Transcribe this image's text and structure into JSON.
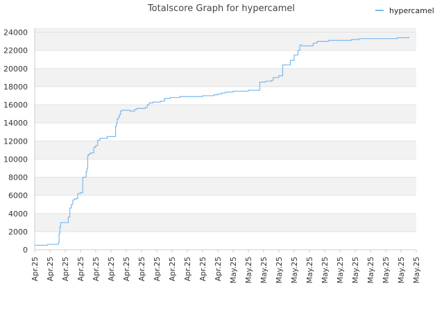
{
  "chart_data": {
    "type": "line",
    "title": "Totalscore Graph for hypercamel",
    "xlabel": "",
    "ylabel": "",
    "ylim": [
      0,
      24500
    ],
    "yticks": [
      0,
      2000,
      4000,
      6000,
      8000,
      10000,
      12000,
      14000,
      16000,
      18000,
      20000,
      22000,
      24000
    ],
    "xticks": [
      "Apr.25",
      "Apr.25",
      "Apr.25",
      "Apr.25",
      "Apr.25",
      "Apr.25",
      "Apr.25",
      "Apr.25",
      "Apr.25",
      "Apr.25",
      "Apr.25",
      "Apr.25",
      "Apr.25",
      "May.25",
      "May.25",
      "May.25",
      "May.25",
      "May.25",
      "May.25",
      "May.25",
      "May.25",
      "May.25",
      "May.25",
      "May.25",
      "May.25",
      "May.25"
    ],
    "grid": true,
    "legend_position": "top-right",
    "series_color": "#7ab8f0",
    "series": [
      {
        "name": "hypercamel",
        "step": true,
        "x": [
          0,
          0.015,
          0.034,
          0.062,
          0.064,
          0.066,
          0.068,
          0.07,
          0.072,
          0.074,
          0.088,
          0.092,
          0.096,
          0.1,
          0.104,
          0.11,
          0.113,
          0.12,
          0.126,
          0.135,
          0.137,
          0.139,
          0.141,
          0.144,
          0.147,
          0.155,
          0.16,
          0.165,
          0.171,
          0.19,
          0.212,
          0.214,
          0.216,
          0.219,
          0.222,
          0.225,
          0.228,
          0.232,
          0.25,
          0.255,
          0.262,
          0.268,
          0.29,
          0.295,
          0.3,
          0.31,
          0.33,
          0.34,
          0.355,
          0.36,
          0.38,
          0.4,
          0.44,
          0.46,
          0.47,
          0.48,
          0.49,
          0.5,
          0.52,
          0.54,
          0.56,
          0.58,
          0.59,
          0.605,
          0.61,
          0.62,
          0.625,
          0.64,
          0.65,
          0.66,
          0.67,
          0.68,
          0.69,
          0.695,
          0.7,
          0.72,
          0.73,
          0.74,
          0.76,
          0.77,
          0.8,
          0.83,
          0.85,
          0.9,
          0.94,
          0.95,
          0.98
        ],
        "values": [
          500,
          500,
          600,
          800,
          1800,
          2500,
          3000,
          3000,
          3000,
          3000,
          3600,
          4600,
          5000,
          5500,
          5600,
          5700,
          6200,
          6300,
          8000,
          8600,
          9000,
          10400,
          10500,
          10600,
          10700,
          11300,
          11500,
          12100,
          12300,
          12500,
          13600,
          13900,
          14400,
          14600,
          14900,
          15300,
          15400,
          15400,
          15300,
          15300,
          15500,
          15600,
          15700,
          16000,
          16200,
          16300,
          16400,
          16700,
          16800,
          16800,
          16900,
          16900,
          17000,
          17000,
          17100,
          17200,
          17300,
          17400,
          17500,
          17500,
          17600,
          17600,
          18500,
          18600,
          18600,
          18700,
          19000,
          19200,
          20400,
          20400,
          20900,
          21500,
          22000,
          22600,
          22500,
          22500,
          22800,
          23000,
          23000,
          23100,
          23100,
          23200,
          23300,
          23300,
          23300,
          23400,
          23450
        ]
      }
    ]
  }
}
